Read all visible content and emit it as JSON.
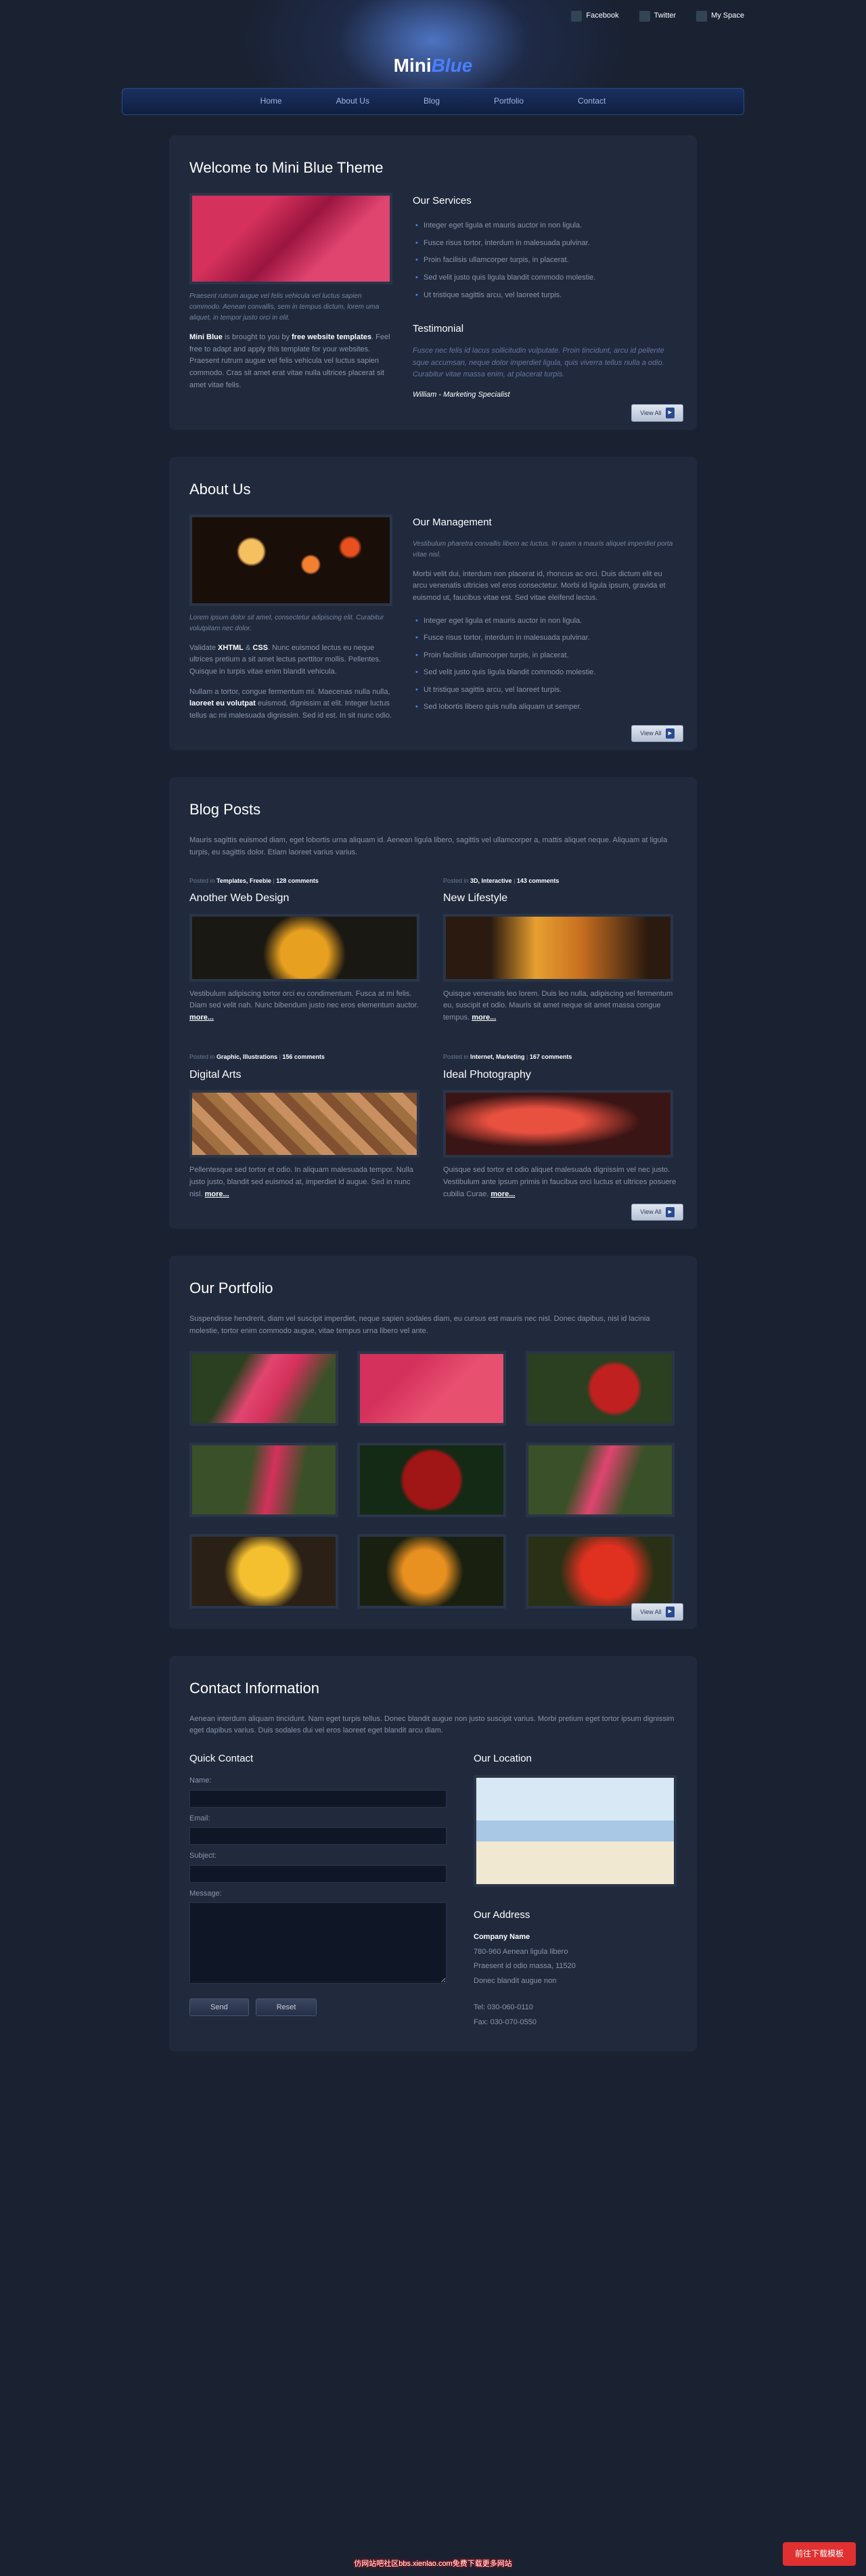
{
  "social": [
    {
      "label": "Facebook"
    },
    {
      "label": "Twitter"
    },
    {
      "label": "My Space"
    }
  ],
  "logo": {
    "a": "Mini",
    "b": "Blue"
  },
  "nav": [
    "Home",
    "About Us",
    "Blog",
    "Portfolio",
    "Contact"
  ],
  "welcome": {
    "title": "Welcome to Mini Blue Theme",
    "caption": "Praesent rutrum augue vel felis vehicula vel luctus sapien commodo. Aenean convallis, sem in tempus dictum, lorem uma aliquet, in tempor justo orci in elit.",
    "credit_a": "Mini Blue",
    "credit_mid": " is brought to you by ",
    "credit_b": "free website templates",
    "credit_rest": ". Feel free to adapt and apply this template for your websites. Praesent rutrum augue vel felis vehicula vel luctus sapien commodo. Cras sit amet erat vitae nulla ultrices placerat sit amet vitae felis.",
    "services_title": "Our Services",
    "services": [
      "Integer eget ligula et mauris auctor in non ligula.",
      "Fusce risus tortor, interdum in malesuada pulvinar.",
      "Proin facilisis ullamcorper turpis, in placerat.",
      "Sed velit justo quis ligula blandit commodo molestie.",
      "Ut tristique sagittis arcu, vel laoreet turpis."
    ],
    "testimonial_title": "Testimonial",
    "testimonial_text": "Fusce nec felis id lacus sollicitudin vulputate. Proin tincidunt, arcu id pellente sque accumsan, neque dolor imperdiet ligula, quis viverra tellus nulla a odio. Curabitur vitae massa enim, at placerat turpis.",
    "testimonial_cite": "William - Marketing Specialist"
  },
  "about": {
    "title": "About Us",
    "caption": "Lorem ipsum dolor sit amet, consectetur adipiscing elit. Curabitur volutpitam nec dolor.",
    "p1a": "Validate ",
    "p1b": "XHTML",
    "p1c": " & ",
    "p1d": "CSS",
    "p1e": ". Nunc euismod lectus eu neque ultrices pretium a sit amet lectus porttitor mollis. Pellentes. Quisque in turpis vitae enim blandit vehicula.",
    "p2a": "Nullam a tortor, congue fermentum mi. Maecenas nulla nulla, ",
    "p2b": "laoreet eu volutpat",
    "p2c": " euismod, dignissim at elit. Integer luctus tellus ac mi malesuada dignissim. Sed id est. In sit nunc odio.",
    "mgmt_title": "Our Management",
    "mgmt_sub": "Vestibulum pharetra convallis libero ac luctus. In quam a mauris aliquet imperdiet porta vitae nisl.",
    "mgmt_p": "Morbi velit dui, interdum non placerat id, rhoncus ac orci. Duis dictum elit eu arcu venenatis ultricies vel eros consectetur. Morbi id ligula ipsum, gravida et euismod ut, faucibus vitae est. Sed vitae eleifend lectus.",
    "mgmt_list": [
      "Integer eget ligula et mauris auctor in non ligula.",
      "Fusce risus tortor, interdum in malesuada pulvinar.",
      "Proin facilisis ullamcorper turpis, in placerat.",
      "Sed velit justo quis ligula blandit commodo molestie.",
      "Ut tristique sagittis arcu, vel laoreet turpis.",
      "Sed lobortis libero quis nulla aliquam ut semper."
    ]
  },
  "blog": {
    "title": "Blog Posts",
    "intro": "Mauris sagittis euismod diam, eget lobortis urna aliquam id. Aenean ligula libero, sagittis vel ullamcorper a, mattis aliquet neque. Aliquam at ligula turpis, eu sagittis dolor. Etiam laoreet varius varius.",
    "posts": [
      {
        "meta_pre": "Posted in ",
        "meta_cat": "Templates, Freebie",
        "meta_sep": " | ",
        "meta_com": "128 comments",
        "title": "Another Web Design",
        "text": "Vestibulum adipiscing tortor orci eu condimentum. Fusca at mi felis. Diam sed velit nah. Nunc bibendum justo nec eros elementum auctor. ",
        "img": "img-blog1"
      },
      {
        "meta_pre": "Posted in ",
        "meta_cat": "3D, Interactive",
        "meta_sep": " | ",
        "meta_com": "143 comments",
        "title": "New Lifestyle",
        "text": "Quisque venenatis leo lorem. Duis leo nulla, adipiscing vel fermentum eu, suscipit et odio. Mauris sit amet neque sit amet massa congue tempus. ",
        "img": "img-blog2"
      },
      {
        "meta_pre": "Posted in ",
        "meta_cat": "Graphic, Illustrations",
        "meta_sep": " | ",
        "meta_com": "156 comments",
        "title": "Digital Arts",
        "text": "Pellentesque sed tortor et odio. In aliquam malesuada tempor. Nulla justo justo, blandit sed euismod at, imperdiet id augue. Sed in nunc nisl. ",
        "img": "img-blog3"
      },
      {
        "meta_pre": "Posted in ",
        "meta_cat": "Internet, Marketing",
        "meta_sep": " | ",
        "meta_com": "167 comments",
        "title": "Ideal Photography",
        "text": "Quisque sed tortor et odio aliquet malesuada dignissim vel nec justo. Vestibulum ante ipsum primis in faucibus orci luctus et ultrices posuere cubilia Curae. ",
        "img": "img-blog4"
      }
    ],
    "more": "more..."
  },
  "portfolio": {
    "title": "Our Portfolio",
    "intro": "Suspendisse hendrerit, diam vel suscipit imperdiet, neque sapien sodales diam, eu cursus est mauris nec nisl. Donec dapibus, nisl id lacinia molestie, tortor enim commodo augue, vitae tempus urna libero vel ante.",
    "images": [
      "img-flower1",
      "img-flower2",
      "img-bell",
      "img-flower3",
      "img-gift",
      "img-flower4",
      "img-yellow2",
      "img-orange",
      "img-red"
    ]
  },
  "contact": {
    "title": "Contact Information",
    "intro": "Aenean interdum aliquam tincidunt. Nam eget turpis tellus. Donec blandit augue non justo suscipit varius. Morbi pretium eget tortor ipsum dignissim eget dapibus varius. Duis sodales dui vel eros laoreet eget blandit arcu diam.",
    "form_title": "Quick Contact",
    "labels": {
      "name": "Name:",
      "email": "Email:",
      "subject": "Subject:",
      "message": "Message:"
    },
    "send": "Send",
    "reset": "Reset",
    "loc_title": "Our Location",
    "addr_title": "Our Address",
    "company": "Company Name",
    "addr1": "780-960 Aenean ligula libero",
    "addr2": "Praesent id odio massa, 11520",
    "addr3": "Donec blandit augue non",
    "tel": "Tel: 030-060-0110",
    "fax": "Fax: 030-070-0550"
  },
  "view_all": "View All",
  "watermark": "仿网站吧社区bbs.xienlao.com免费下载更多网站",
  "red_btn": "前往下载模板"
}
